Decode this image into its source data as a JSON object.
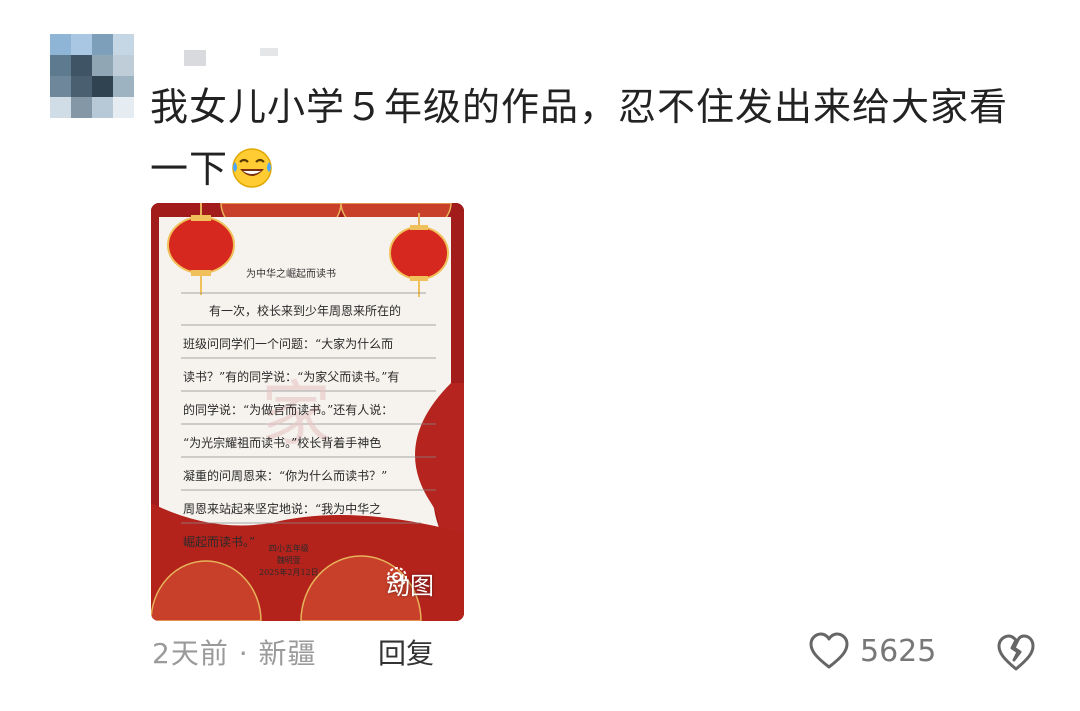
{
  "comment": {
    "text": "我女儿小学５年级的作品，忍不住发出来给大家看一下",
    "emoji": "laughing-tears-emoji",
    "avatar_colors": [
      "#8fb5d6",
      "#a9c7e2",
      "#7e9fb9",
      "#c5d6e4",
      "#5d7a8f",
      "#3f5566",
      "#90a6b4",
      "#bfcdd8",
      "#6e879a",
      "#4a6070",
      "#2f4350",
      "#9eb3c1",
      "#d0dce6",
      "#8497a6",
      "#b7c8d6",
      "#e6edf2"
    ]
  },
  "attachment": {
    "badge_label": "动图",
    "essay_title": "为中华之崛起而读书",
    "essay_lines": [
      "有一次，校长来到少年周恩来所在的",
      "班级问同学们一个问题：“大家为什么而",
      "读书？”有的同学说：“为家父而读书。”有",
      "的同学说：“为做官而读书。”还有人说：",
      "“为光宗耀祖而读书。”校长背着手神色",
      "凝重的问周恩来：“你为什么而读书？”",
      "周恩来站起来坚定地说：“我为中华之",
      "崛起而读书。”"
    ],
    "signature_lines": [
      "四小五年级",
      "魏明萱",
      "2025年2月12日"
    ]
  },
  "footer": {
    "time_location": "2天前 · 新疆",
    "reply_label": "回复",
    "like_count": "5625",
    "like_icon": "heart-outline-icon",
    "dislike_icon": "broken-heart-icon"
  }
}
